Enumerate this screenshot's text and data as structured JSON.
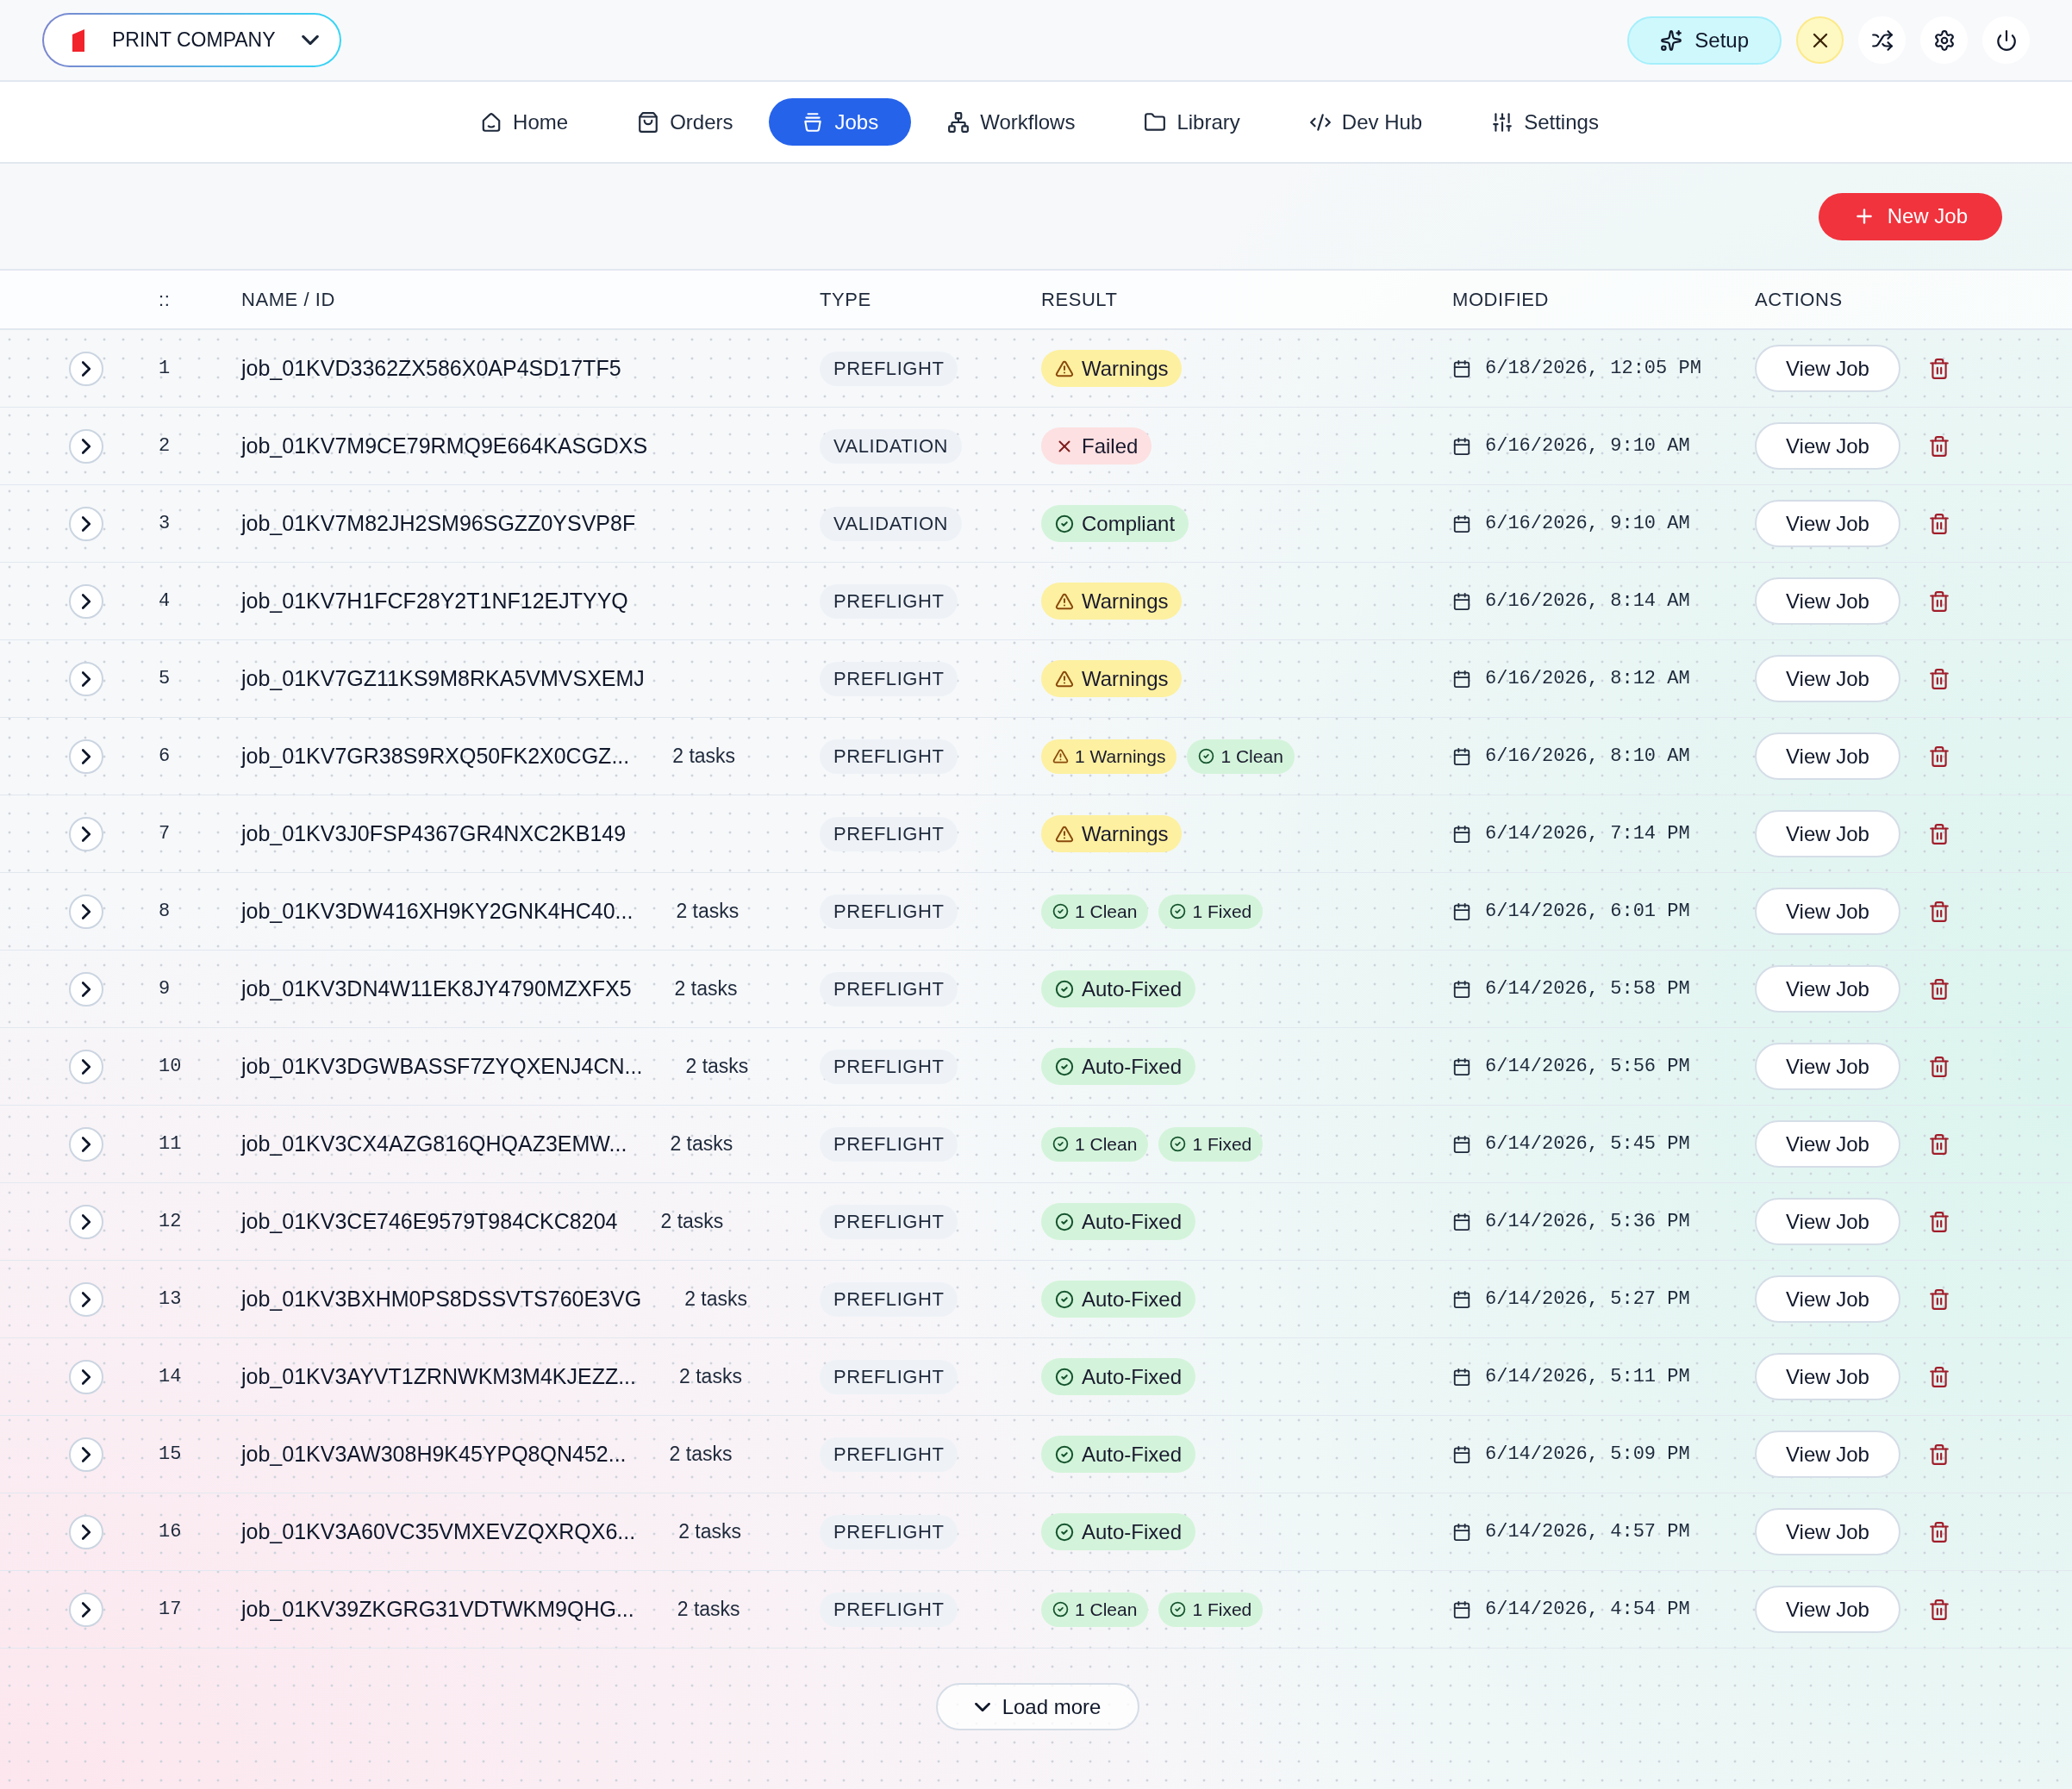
{
  "company_selector": {
    "label": "PRINT COMPANY"
  },
  "toolbar": {
    "setup_button": "Setup"
  },
  "nav": {
    "tabs": [
      {
        "label": "Home",
        "selected": false
      },
      {
        "label": "Orders",
        "selected": false
      },
      {
        "label": "Jobs",
        "selected": true
      },
      {
        "label": "Workflows",
        "selected": false
      },
      {
        "label": "Library",
        "selected": false
      },
      {
        "label": "Dev Hub",
        "selected": false
      },
      {
        "label": "Settings",
        "selected": false
      }
    ]
  },
  "new_job_button": "New Job",
  "table": {
    "columns": [
      "::",
      "NAME / ID",
      "TYPE",
      "RESULT",
      "MODIFIED",
      "ACTIONS"
    ],
    "rows": [
      {
        "expanded": false,
        "number": "1",
        "name": "job_01KVD3362ZX586X0AP4SD17TF5",
        "type": "PREFLIGHT",
        "results": [
          {
            "label": "Warnings",
            "kind": "warning"
          }
        ],
        "modified": "6/18/2026, 12:05 PM",
        "action": "View Job"
      },
      {
        "expanded": false,
        "number": "2",
        "name": "job_01KV7M9CE79RMQ9E664KASGDXS",
        "type": "VALIDATION",
        "results": [
          {
            "label": "Failed",
            "kind": "error"
          }
        ],
        "modified": "6/16/2026, 9:10 AM",
        "action": "View Job"
      },
      {
        "expanded": false,
        "number": "3",
        "name": "job_01KV7M82JH2SM96SGZZ0YSVP8F",
        "type": "VALIDATION",
        "results": [
          {
            "label": "Compliant",
            "kind": "success"
          }
        ],
        "modified": "6/16/2026, 9:10 AM",
        "action": "View Job"
      },
      {
        "expanded": false,
        "number": "4",
        "name": "job_01KV7H1FCF28Y2T1NF12EJTYYQ",
        "type": "PREFLIGHT",
        "results": [
          {
            "label": "Warnings",
            "kind": "warning"
          }
        ],
        "modified": "6/16/2026, 8:14 AM",
        "action": "View Job"
      },
      {
        "expanded": false,
        "number": "5",
        "name": "job_01KV7GZ11KS9M8RKA5VMVSXEMJ",
        "type": "PREFLIGHT",
        "results": [
          {
            "label": "Warnings",
            "kind": "warning"
          }
        ],
        "modified": "6/16/2026, 8:12 AM",
        "action": "View Job"
      },
      {
        "expanded": false,
        "number": "6",
        "name": "job_01KV7GR38S9RXQ50FK2X0CGZ...",
        "tasks": "2 tasks",
        "type": "PREFLIGHT",
        "results": [
          {
            "label": "1 Warnings",
            "kind": "warning"
          },
          {
            "label": "1 Clean",
            "kind": "success"
          }
        ],
        "modified": "6/16/2026, 8:10 AM",
        "action": "View Job"
      },
      {
        "expanded": false,
        "number": "7",
        "name": "job_01KV3J0FSP4367GR4NXC2KB149",
        "type": "PREFLIGHT",
        "results": [
          {
            "label": "Warnings",
            "kind": "warning"
          }
        ],
        "modified": "6/14/2026, 7:14 PM",
        "action": "View Job"
      },
      {
        "expanded": false,
        "number": "8",
        "name": "job_01KV3DW416XH9KY2GNK4HC40...",
        "tasks": "2 tasks",
        "type": "PREFLIGHT",
        "results": [
          {
            "label": "1 Clean",
            "kind": "success"
          },
          {
            "label": "1 Fixed",
            "kind": "success"
          }
        ],
        "modified": "6/14/2026, 6:01 PM",
        "action": "View Job"
      },
      {
        "expanded": false,
        "number": "9",
        "name": "job_01KV3DN4W11EK8JY4790MZXFX5",
        "tasks": "2 tasks",
        "type": "PREFLIGHT",
        "results": [
          {
            "label": "Auto-Fixed",
            "kind": "success"
          }
        ],
        "modified": "6/14/2026, 5:58 PM",
        "action": "View Job"
      },
      {
        "expanded": false,
        "number": "10",
        "name": "job_01KV3DGWBASSF7ZYQXENJ4CN...",
        "tasks": "2 tasks",
        "type": "PREFLIGHT",
        "results": [
          {
            "label": "Auto-Fixed",
            "kind": "success"
          }
        ],
        "modified": "6/14/2026, 5:56 PM",
        "action": "View Job"
      },
      {
        "expanded": false,
        "number": "11",
        "name": "job_01KV3CX4AZG816QHQAZ3EMW...",
        "tasks": "2 tasks",
        "type": "PREFLIGHT",
        "results": [
          {
            "label": "1 Clean",
            "kind": "success"
          },
          {
            "label": "1 Fixed",
            "kind": "success"
          }
        ],
        "modified": "6/14/2026, 5:45 PM",
        "action": "View Job"
      },
      {
        "expanded": false,
        "number": "12",
        "name": "job_01KV3CE746E9579T984CKC8204",
        "tasks": "2 tasks",
        "type": "PREFLIGHT",
        "results": [
          {
            "label": "Auto-Fixed",
            "kind": "success"
          }
        ],
        "modified": "6/14/2026, 5:36 PM",
        "action": "View Job"
      },
      {
        "expanded": false,
        "number": "13",
        "name": "job_01KV3BXHM0PS8DSSVTS760E3VG",
        "tasks": "2 tasks",
        "type": "PREFLIGHT",
        "results": [
          {
            "label": "Auto-Fixed",
            "kind": "success"
          }
        ],
        "modified": "6/14/2026, 5:27 PM",
        "action": "View Job"
      },
      {
        "expanded": false,
        "number": "14",
        "name": "job_01KV3AYVT1ZRNWKM3M4KJEZZ...",
        "tasks": "2 tasks",
        "type": "PREFLIGHT",
        "results": [
          {
            "label": "Auto-Fixed",
            "kind": "success"
          }
        ],
        "modified": "6/14/2026, 5:11 PM",
        "action": "View Job"
      },
      {
        "expanded": false,
        "number": "15",
        "name": "job_01KV3AW308H9K45YPQ8QN452...",
        "tasks": "2 tasks",
        "type": "PREFLIGHT",
        "results": [
          {
            "label": "Auto-Fixed",
            "kind": "success"
          }
        ],
        "modified": "6/14/2026, 5:09 PM",
        "action": "View Job"
      },
      {
        "expanded": false,
        "number": "16",
        "name": "job_01KV3A60VC35VMXEVZQXRQX6...",
        "tasks": "2 tasks",
        "type": "PREFLIGHT",
        "results": [
          {
            "label": "Auto-Fixed",
            "kind": "success"
          }
        ],
        "modified": "6/14/2026, 4:57 PM",
        "action": "View Job"
      },
      {
        "expanded": false,
        "number": "17",
        "name": "job_01KV39ZKGRG31VDTWKM9QHG...",
        "tasks": "2 tasks",
        "type": "PREFLIGHT",
        "results": [
          {
            "label": "1 Clean",
            "kind": "success"
          },
          {
            "label": "1 Fixed",
            "kind": "success"
          }
        ],
        "modified": "6/14/2026, 4:54 PM",
        "action": "View Job"
      }
    ]
  },
  "load_more_button": "Load more"
}
